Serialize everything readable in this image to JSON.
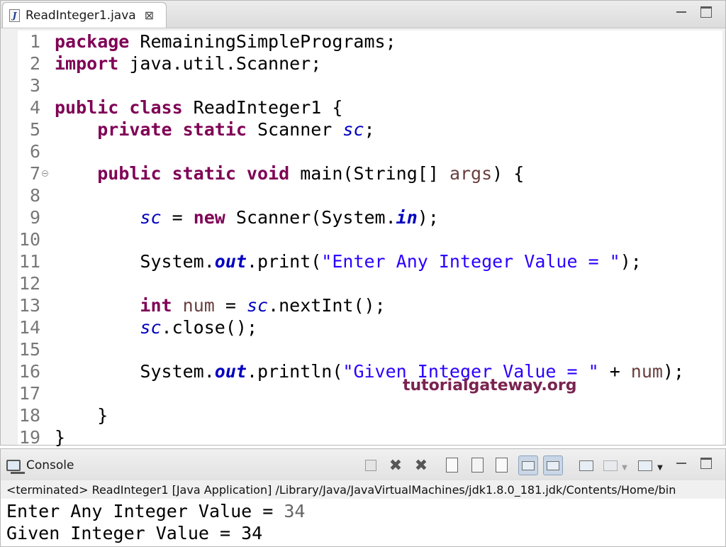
{
  "editor": {
    "tab_label": "ReadInteger1.java",
    "file_icon_glyph": "J",
    "close_glyph": "⊠",
    "line_numbers": [
      "1",
      "2",
      "3",
      "4",
      "5",
      "6",
      "7",
      "8",
      "9",
      "10",
      "11",
      "12",
      "13",
      "14",
      "15",
      "16",
      "17",
      "18",
      "19"
    ],
    "code": {
      "l1": {
        "kw": "package",
        "rest": " RemainingSimplePrograms;"
      },
      "l2": {
        "kw": "import",
        "rest": " java.util.Scanner;"
      },
      "l4": {
        "kw": "public class",
        "rest": " ReadInteger1 {"
      },
      "l5": {
        "indent": "    ",
        "kw": "private static",
        "mid": " Scanner ",
        "field": "sc",
        "end": ";"
      },
      "l7": {
        "indent": "    ",
        "kw": "public static void",
        "mid": " main(String[] ",
        "var": "args",
        "end": ") {"
      },
      "l9": {
        "indent": "        ",
        "field": "sc",
        "a": " = ",
        "kw": "new",
        "b": " Scanner(System.",
        "fieldb": "in",
        "end": ");"
      },
      "l11": {
        "indent": "        ",
        "a": "System.",
        "fieldb": "out",
        "b": ".print(",
        "str": "\"Enter Any Integer Value = \"",
        "end": ");"
      },
      "l13": {
        "indent": "        ",
        "kw": "int",
        "a": " ",
        "var": "num",
        "b": " = ",
        "field": "sc",
        "end": ".nextInt();"
      },
      "l14": {
        "indent": "        ",
        "field": "sc",
        "end": ".close();"
      },
      "l16": {
        "indent": "        ",
        "a": "System.",
        "fieldb": "out",
        "b": ".println(",
        "str": "\"Given Integer Value = \"",
        "c": " + ",
        "var": "num",
        "end": ");"
      },
      "l18": {
        "text": "    }"
      },
      "l19": {
        "text": "}"
      }
    },
    "watermark": "tutorialgateway.org"
  },
  "console": {
    "tab_label": "Console",
    "terminated_line": "<terminated> ReadInteger1 [Java Application] /Library/Java/JavaVirtualMachines/jdk1.8.0_181.jdk/Contents/Home/bin",
    "output": {
      "line1_prompt": "Enter Any Integer Value = ",
      "line1_input": "34",
      "line2": "Given Integer Value = 34"
    }
  },
  "colors": {
    "keyword": "#7f0055",
    "field": "#0000c0",
    "string": "#2a00ff",
    "local_var": "#6a3e3e",
    "line_number": "#787878",
    "watermark": "#7a2350"
  }
}
